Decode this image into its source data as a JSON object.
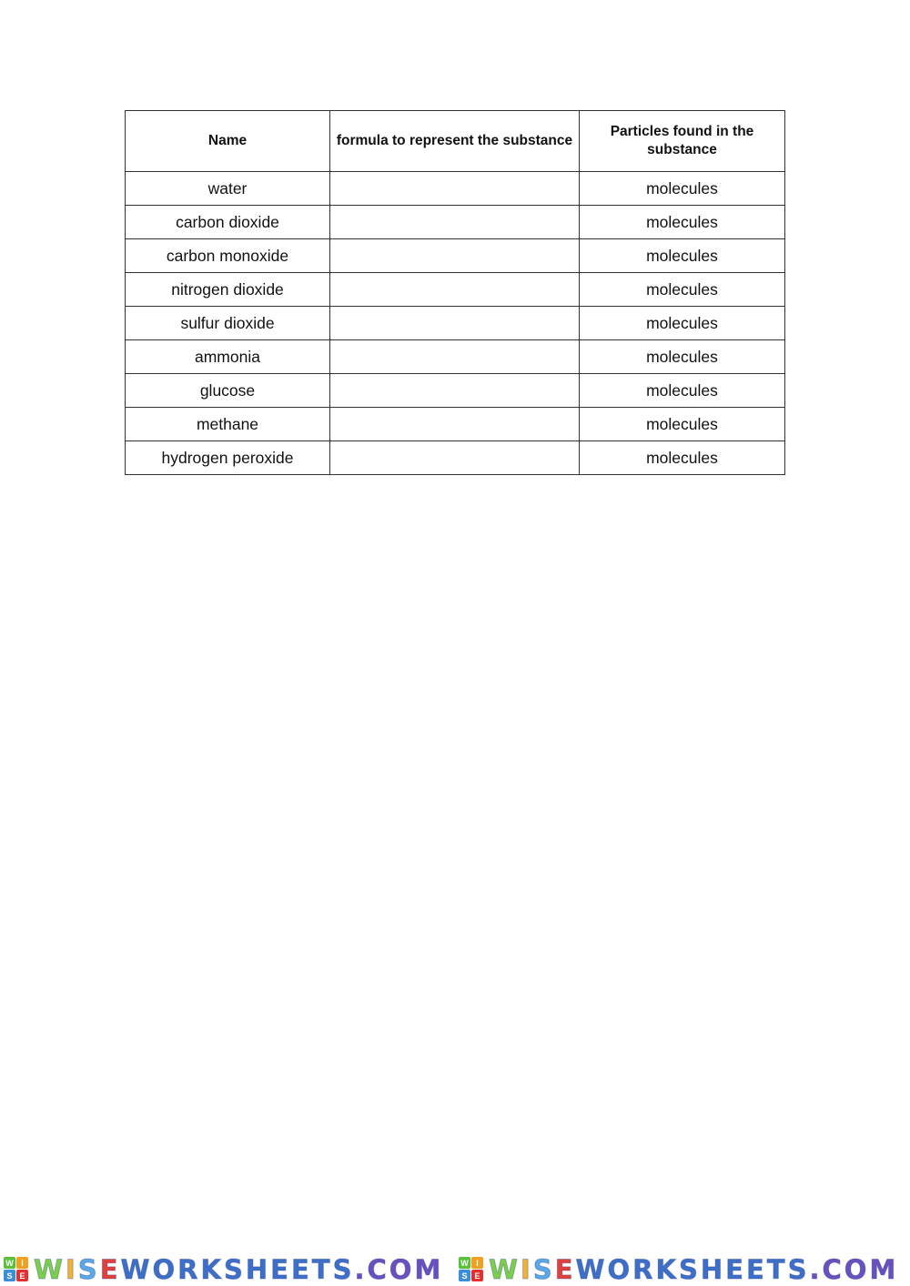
{
  "table": {
    "headers": [
      "Name",
      "formula to represent the substance",
      "Particles found in the substance"
    ],
    "rows": [
      {
        "name": "water",
        "formula": "",
        "particles": "molecules"
      },
      {
        "name": "carbon dioxide",
        "formula": "",
        "particles": "molecules"
      },
      {
        "name": "carbon monoxide",
        "formula": "",
        "particles": "molecules"
      },
      {
        "name": "nitrogen dioxide",
        "formula": "",
        "particles": "molecules"
      },
      {
        "name": "sulfur dioxide",
        "formula": "",
        "particles": "molecules"
      },
      {
        "name": "ammonia",
        "formula": "",
        "particles": "molecules"
      },
      {
        "name": "glucose",
        "formula": "",
        "particles": "molecules"
      },
      {
        "name": "methane",
        "formula": "",
        "particles": "molecules"
      },
      {
        "name": "hydrogen peroxide",
        "formula": "",
        "particles": "molecules"
      }
    ]
  },
  "footer": {
    "logo_letters": [
      "W",
      "I",
      "S",
      "E"
    ],
    "logo_colors": [
      "#5bbf3a",
      "#f0a020",
      "#3a8fd8",
      "#e03030"
    ],
    "brand": "WISEWORKSHEETS.COM",
    "brand_colors": {
      "W1": "#7ccf4a",
      "I": "#f2b233",
      "S1": "#5aa8e6",
      "E1": "#e2403a",
      "rest": "#3d6fc9",
      "tail": "#6a4fc0"
    }
  }
}
